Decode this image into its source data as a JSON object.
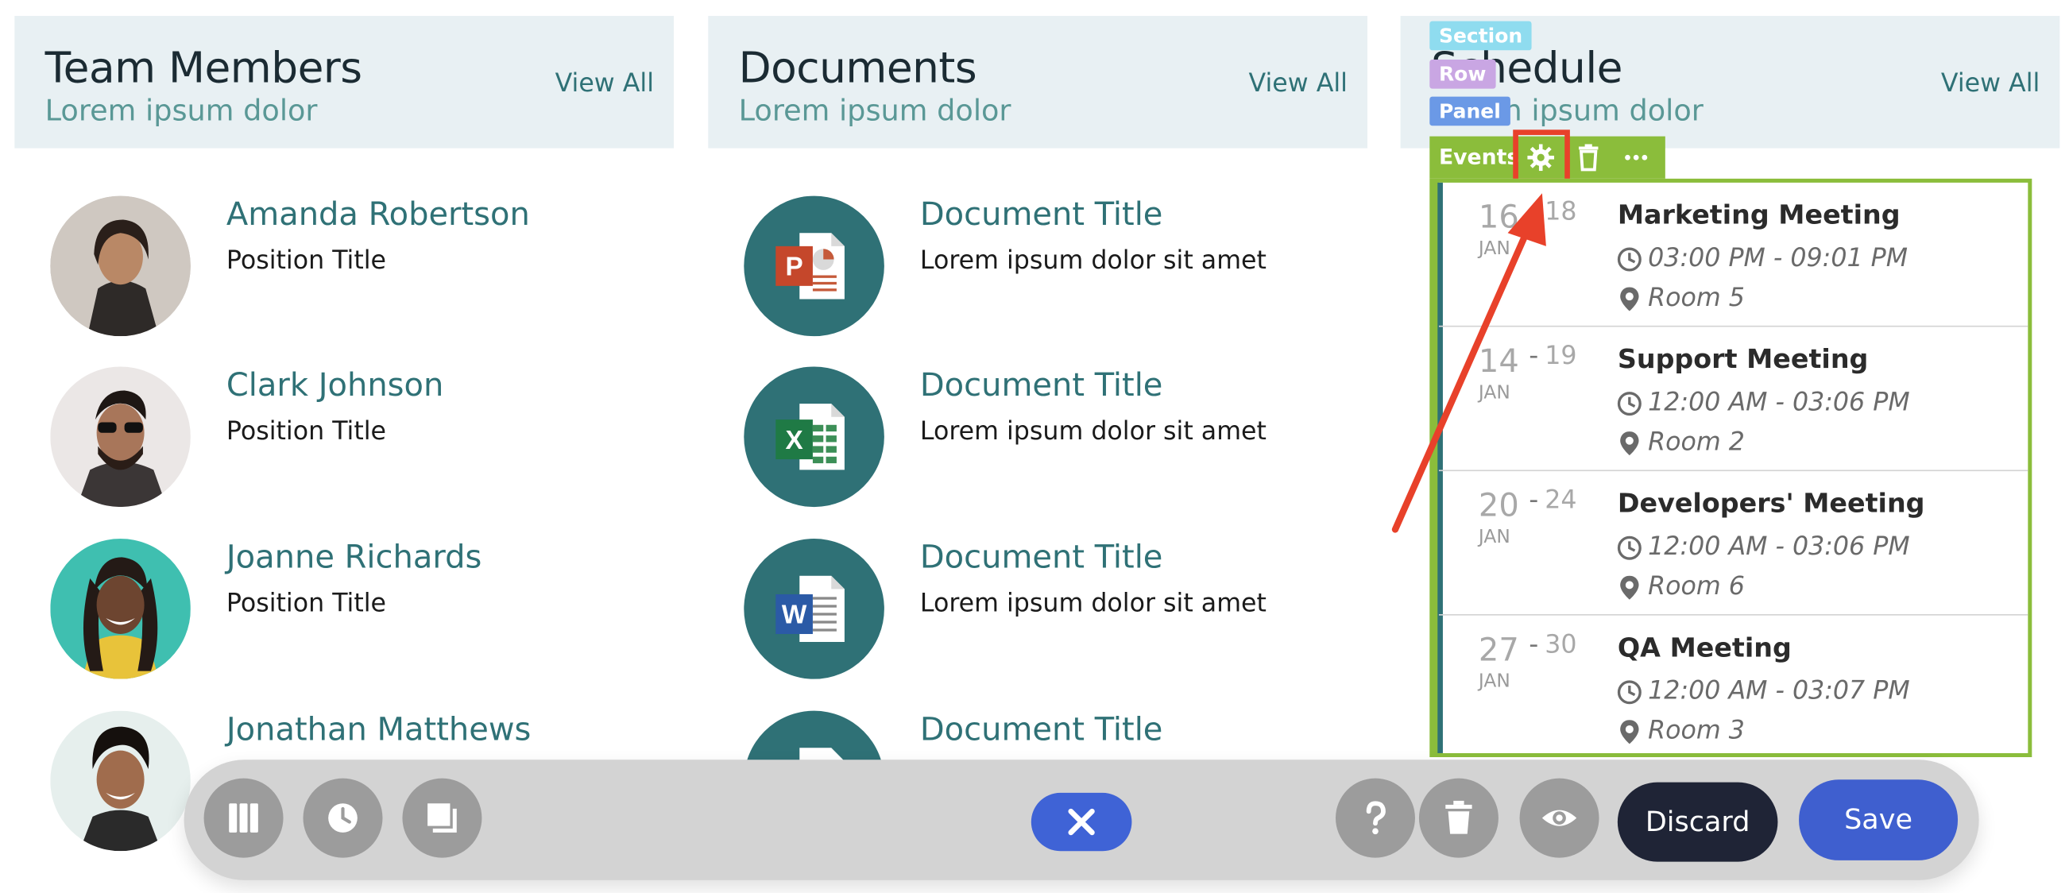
{
  "team": {
    "title": "Team Members",
    "subtitle": "Lorem ipsum dolor",
    "view_all": "View All",
    "members": [
      {
        "name": "Amanda Robertson",
        "position": "Position Title"
      },
      {
        "name": "Clark Johnson",
        "position": "Position Title"
      },
      {
        "name": "Joanne Richards",
        "position": "Position Title"
      },
      {
        "name": "Jonathan Matthews",
        "position": ""
      }
    ]
  },
  "documents": {
    "title": "Documents",
    "subtitle": "Lorem ipsum dolor",
    "view_all": "View All",
    "items": [
      {
        "title": "Document Title",
        "desc": "Lorem ipsum dolor sit amet",
        "icon": "powerpoint-icon"
      },
      {
        "title": "Document Title",
        "desc": "Lorem ipsum dolor sit amet",
        "icon": "excel-icon"
      },
      {
        "title": "Document Title",
        "desc": "Lorem ipsum dolor sit amet",
        "icon": "word-icon"
      },
      {
        "title": "Document Title",
        "desc": "",
        "icon": "powerpoint-icon"
      }
    ]
  },
  "schedule": {
    "title": "Schedule",
    "subtitle": "Lorem ipsum dolor",
    "view_all": "View All",
    "badges": {
      "section": "Section",
      "row": "Row",
      "panel": "Panel"
    },
    "events_toolbar": {
      "label": "Events",
      "icons": [
        "gear-icon",
        "trash-icon",
        "more-icon"
      ]
    },
    "events": [
      {
        "day_start": "16",
        "day_end": "18",
        "month": "JAN",
        "title": "Marketing Meeting",
        "time": "03:00 PM - 09:01 PM",
        "room": "Room 5"
      },
      {
        "day_start": "14",
        "day_end": "19",
        "month": "JAN",
        "title": "Support Meeting",
        "time": "12:00 AM - 03:06 PM",
        "room": "Room 2"
      },
      {
        "day_start": "20",
        "day_end": "24",
        "month": "JAN",
        "title": "Developers' Meeting",
        "time": "12:00 AM - 03:06 PM",
        "room": "Room 6"
      },
      {
        "day_start": "27",
        "day_end": "30",
        "month": "JAN",
        "title": "QA Meeting",
        "time": "12:00 AM - 03:07 PM",
        "room": "Room 3"
      }
    ]
  },
  "bottom_toolbar": {
    "icons": [
      "columns-icon",
      "history-icon",
      "layers-icon",
      "close-icon",
      "help-icon",
      "trash-icon",
      "eye-icon"
    ],
    "discard_label": "Discard",
    "save_label": "Save"
  },
  "colors": {
    "accent": "#2f7176",
    "header_bg": "#e8f0f3",
    "events_green": "#8bbd3b",
    "highlight_red": "#e8412a",
    "save_blue": "#3f5fcf",
    "discard_dark": "#1f2436"
  }
}
